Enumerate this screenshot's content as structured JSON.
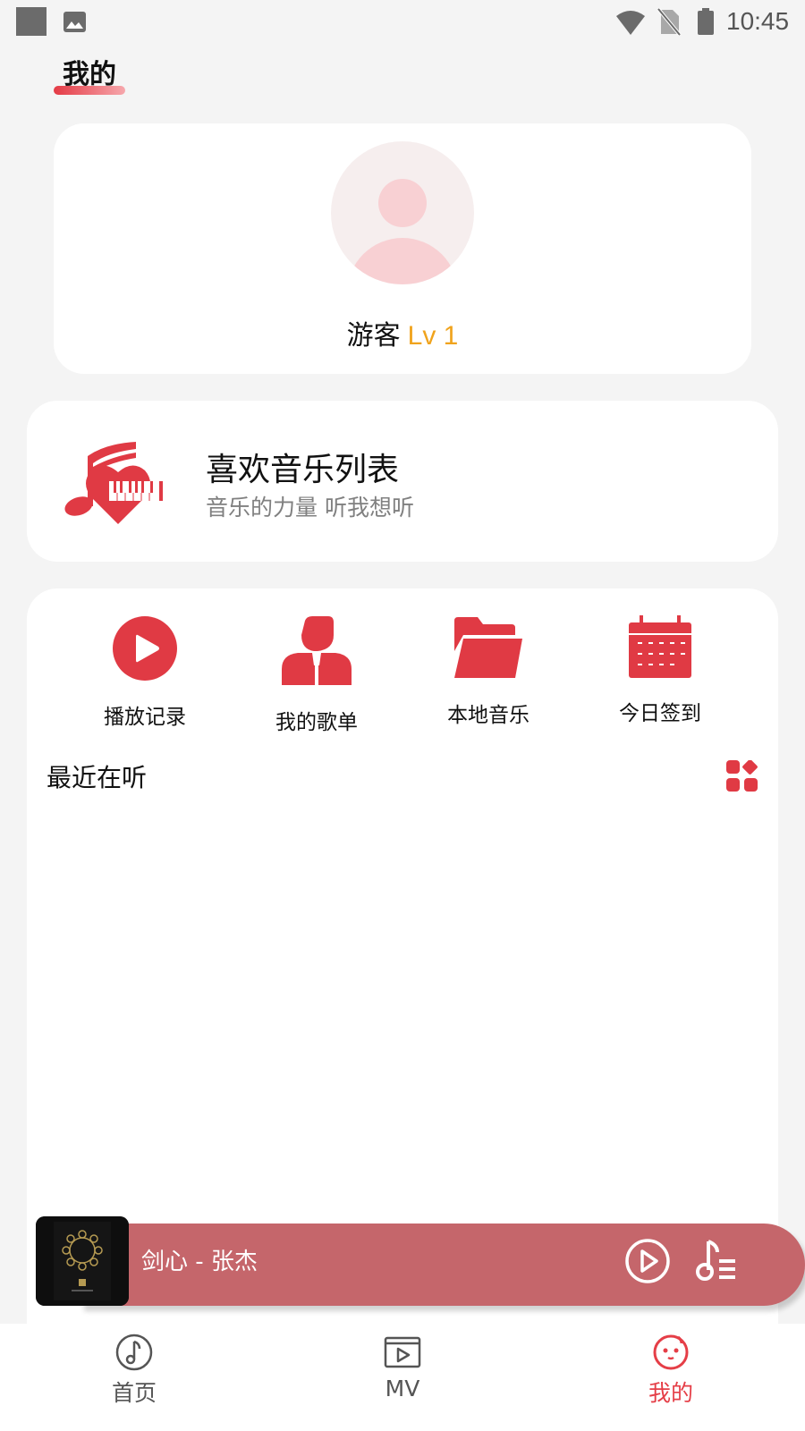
{
  "status_bar": {
    "time": "10:45",
    "icons": [
      "notification-square-icon",
      "image-icon",
      "wifi-icon",
      "no-sim-icon",
      "battery-icon"
    ]
  },
  "header": {
    "active_tab": "我的"
  },
  "profile": {
    "name": "游客",
    "level": "Lv 1"
  },
  "favorites": {
    "title": "喜欢音乐列表",
    "subtitle": "音乐的力量 听我想听"
  },
  "quick_actions": [
    {
      "label": "播放记录",
      "icon": "play-circle-icon"
    },
    {
      "label": "我的歌单",
      "icon": "user-playlist-icon"
    },
    {
      "label": "本地音乐",
      "icon": "folder-icon"
    },
    {
      "label": "今日签到",
      "icon": "calendar-icon"
    }
  ],
  "recent": {
    "title": "最近在听"
  },
  "player": {
    "song": "剑心 - 张杰"
  },
  "bottom_nav": [
    {
      "label": "首页",
      "icon": "music-disc-icon",
      "active": false
    },
    {
      "label": "MV",
      "icon": "video-play-icon",
      "active": false
    },
    {
      "label": "我的",
      "icon": "smiley-face-icon",
      "active": true
    }
  ],
  "colors": {
    "accent": "#e53e47",
    "level": "#f0a31c",
    "player_bar": "#c5666b",
    "background": "#f4f4f4"
  }
}
